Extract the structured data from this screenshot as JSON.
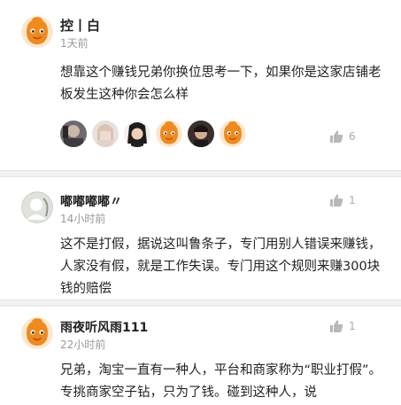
{
  "comments": [
    {
      "username": "控丨白",
      "time": "1天前",
      "content": "想靠这个赚钱兄弟你换位思考一下，如果你是这家店铺老板发生这种你会怎么样",
      "like_count": "6"
    },
    {
      "username": "嘟嘟嘟嘟〃",
      "time": "14小时前",
      "content": "这不是打假，据说这叫鲁条子，专门用别人错误来赚钱，人家没有假，就是工作失误。专门用这个规则来赚300块钱的赔偿",
      "like_count": "1"
    },
    {
      "username": "雨夜听风雨111",
      "time": "22小时前",
      "content": "兄弟，淘宝一直有一种人，平台和商家称为“职业打假”。专挑商家空子钻，只为了钱。碰到这种人，说",
      "like_count": "1"
    }
  ],
  "icons": {
    "avatar_default": "orange-face-avatar",
    "like": "thumbs-up-icon"
  },
  "colors": {
    "avatar_orange": "#f08a1c",
    "meta_gray": "#999999"
  }
}
